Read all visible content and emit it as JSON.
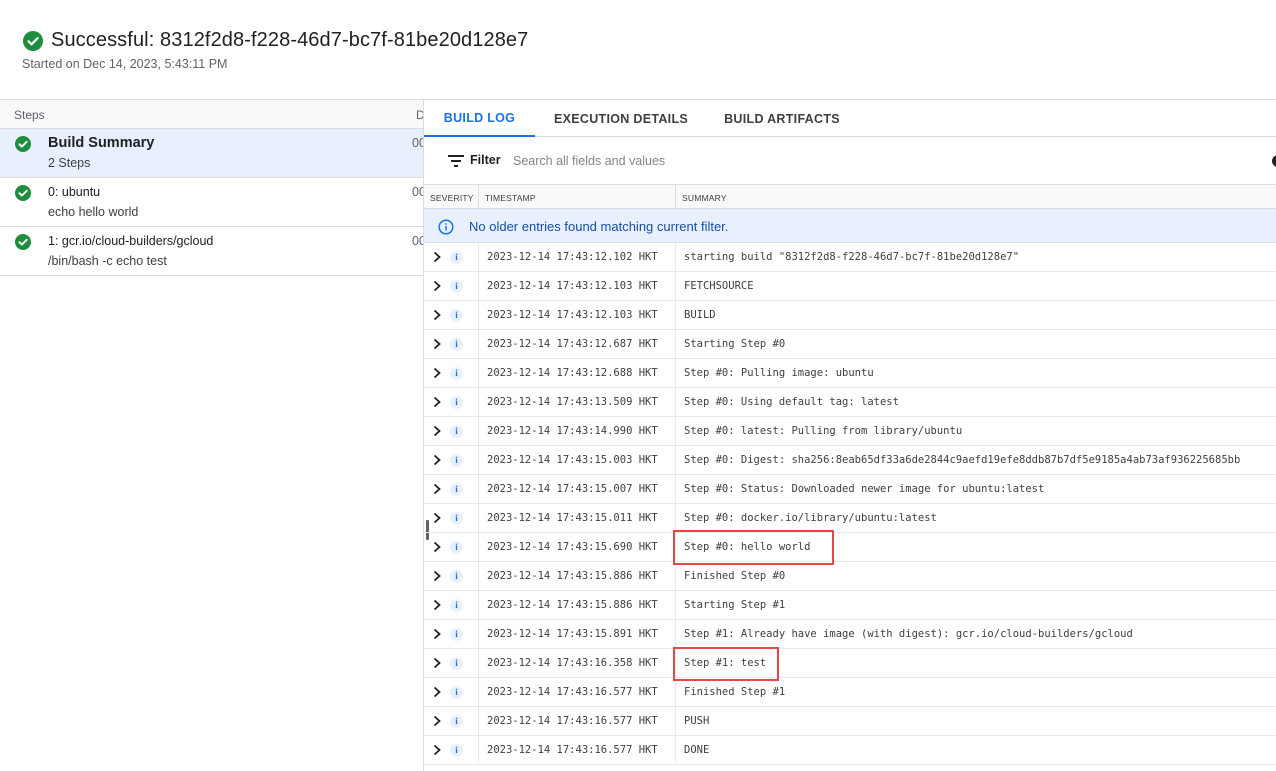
{
  "header": {
    "title": "Successful: 8312f2d8-f228-46d7-bc7f-81be20d128e7",
    "subtitle": "Started on Dec 14, 2023, 5:43:11 PM"
  },
  "colors": {
    "success": "#1e8e3e",
    "accent": "#1a73e8",
    "highlight": "#e8474a"
  },
  "steps": {
    "header_steps": "Steps",
    "header_duration": "D",
    "items": [
      {
        "name": "Build Summary",
        "sub": "2 Steps",
        "duration": "00"
      },
      {
        "name": "0: ubuntu",
        "sub": "echo hello world",
        "duration": "00"
      },
      {
        "name": "1: gcr.io/cloud-builders/gcloud",
        "sub": "/bin/bash -c echo test",
        "duration": "00"
      }
    ]
  },
  "tabs": [
    "BUILD LOG",
    "EXECUTION DETAILS",
    "BUILD ARTIFACTS"
  ],
  "filter": {
    "label": "Filter",
    "placeholder": "Search all fields and values"
  },
  "log_columns": {
    "severity": "SEVERITY",
    "timestamp": "TIMESTAMP",
    "summary": "SUMMARY"
  },
  "banner": "No older entries found matching current filter.",
  "severity_glyph": "i",
  "log_rows": [
    {
      "ts": "2023-12-14 17:43:12.102 HKT",
      "summary": "starting build \"8312f2d8-f228-46d7-bc7f-81be20d128e7\""
    },
    {
      "ts": "2023-12-14 17:43:12.103 HKT",
      "summary": "FETCHSOURCE"
    },
    {
      "ts": "2023-12-14 17:43:12.103 HKT",
      "summary": "BUILD"
    },
    {
      "ts": "2023-12-14 17:43:12.687 HKT",
      "summary": "Starting Step #0"
    },
    {
      "ts": "2023-12-14 17:43:12.688 HKT",
      "summary": "Step #0: Pulling image: ubuntu"
    },
    {
      "ts": "2023-12-14 17:43:13.509 HKT",
      "summary": "Step #0: Using default tag: latest"
    },
    {
      "ts": "2023-12-14 17:43:14.990 HKT",
      "summary": "Step #0: latest: Pulling from library/ubuntu"
    },
    {
      "ts": "2023-12-14 17:43:15.003 HKT",
      "summary": "Step #0: Digest: sha256:8eab65df33a6de2844c9aefd19efe8ddb87b7df5e9185a4ab73af936225685bb"
    },
    {
      "ts": "2023-12-14 17:43:15.007 HKT",
      "summary": "Step #0: Status: Downloaded newer image for ubuntu:latest"
    },
    {
      "ts": "2023-12-14 17:43:15.011 HKT",
      "summary": "Step #0: docker.io/library/ubuntu:latest"
    },
    {
      "ts": "2023-12-14 17:43:15.690 HKT",
      "summary": "Step #0: hello world"
    },
    {
      "ts": "2023-12-14 17:43:15.886 HKT",
      "summary": "Finished Step #0"
    },
    {
      "ts": "2023-12-14 17:43:15.886 HKT",
      "summary": "Starting Step #1"
    },
    {
      "ts": "2023-12-14 17:43:15.891 HKT",
      "summary": "Step #1: Already have image (with digest): gcr.io/cloud-builders/gcloud"
    },
    {
      "ts": "2023-12-14 17:43:16.358 HKT",
      "summary": "Step #1: test"
    },
    {
      "ts": "2023-12-14 17:43:16.577 HKT",
      "summary": "Finished Step #1"
    },
    {
      "ts": "2023-12-14 17:43:16.577 HKT",
      "summary": "PUSH"
    },
    {
      "ts": "2023-12-14 17:43:16.577 HKT",
      "summary": "DONE"
    }
  ]
}
